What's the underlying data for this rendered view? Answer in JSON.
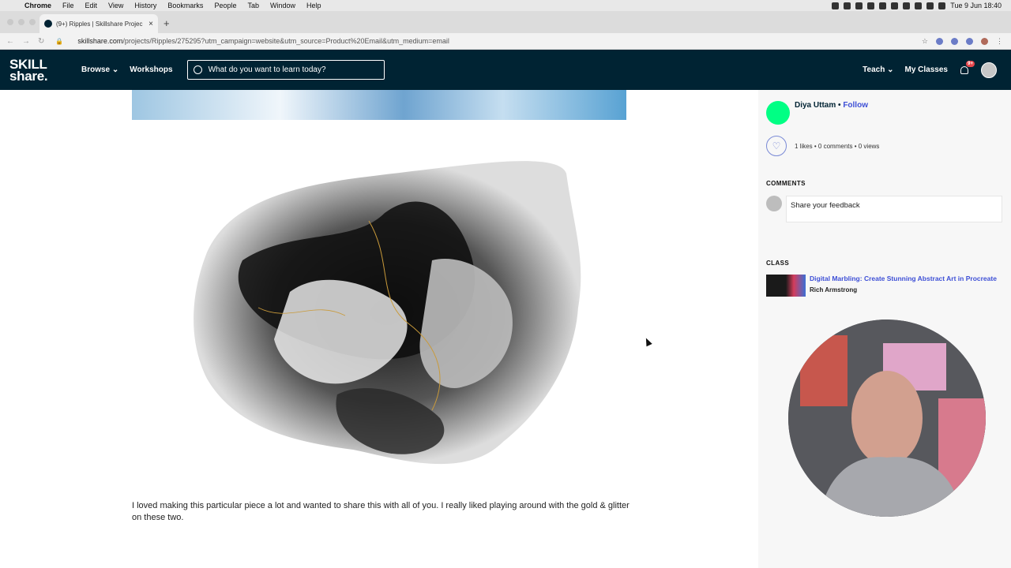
{
  "os_menubar": {
    "app": "Chrome",
    "items": [
      "File",
      "Edit",
      "View",
      "History",
      "Bookmarks",
      "People",
      "Tab",
      "Window",
      "Help"
    ],
    "clock": "Tue 9 Jun  18:40"
  },
  "browser": {
    "tab_title": "(9+) Ripples | Skillshare Projec",
    "url_domain": "skillshare.com",
    "url_path": "/projects/Ripples/275295?utm_campaign=website&utm_source=Product%20Email&utm_medium=email"
  },
  "site_header": {
    "logo_line1": "SKILL",
    "logo_line2": "share.",
    "browse_label": "Browse",
    "workshops_label": "Workshops",
    "search_placeholder": "What do you want to learn today?",
    "teach_label": "Teach",
    "my_classes_label": "My Classes",
    "notification_badge": "9+"
  },
  "project": {
    "caption": "I loved making this particular piece a lot and wanted to share this with all of you. I really liked playing around with the gold & glitter on these two."
  },
  "sidebar": {
    "author_name": "Diya Uttam",
    "follow_label": "Follow",
    "stats": "1 likes • 0 comments • 0 views",
    "comments_heading": "COMMENTS",
    "comment_placeholder": "Share your feedback",
    "class_heading": "CLASS",
    "class_title": "Digital Marbling: Create Stunning Abstract Art in Procreate",
    "class_author": "Rich Armstrong"
  },
  "colors": {
    "header_bg": "#002333",
    "brand_green": "#00ff84",
    "link_blue": "#3d4fd6",
    "sidebar_bg": "#f7f7f7"
  }
}
